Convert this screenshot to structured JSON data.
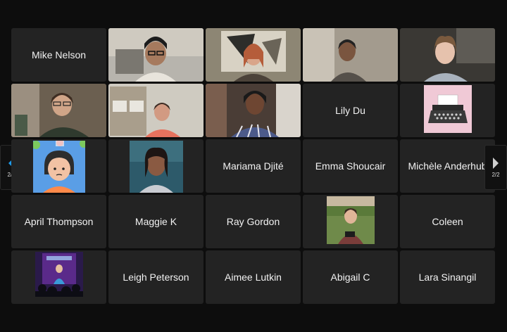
{
  "pagination": {
    "left_label": "2/2",
    "right_label": "2/2"
  },
  "participants": [
    {
      "name": "Mike Nelson",
      "video": false
    },
    {
      "name": "",
      "video": true,
      "icon": "person-video"
    },
    {
      "name": "",
      "video": true,
      "icon": "person-video"
    },
    {
      "name": "",
      "video": true,
      "icon": "person-video"
    },
    {
      "name": "",
      "video": true,
      "icon": "person-video"
    },
    {
      "name": "",
      "video": true,
      "icon": "person-video"
    },
    {
      "name": "",
      "video": true,
      "icon": "person-video"
    },
    {
      "name": "",
      "video": true,
      "icon": "person-video"
    },
    {
      "name": "Lily Du",
      "video": false
    },
    {
      "name": "",
      "video": false,
      "icon": "typewriter-avatar"
    },
    {
      "name": "",
      "video": false,
      "icon": "cartoon-avatar"
    },
    {
      "name": "",
      "video": false,
      "icon": "profile-photo"
    },
    {
      "name": "Mariama Djité",
      "video": false
    },
    {
      "name": "Emma Shoucair",
      "video": false
    },
    {
      "name": "Michèle Anderhub",
      "video": false
    },
    {
      "name": "April Thompson",
      "video": false
    },
    {
      "name": "Maggie K",
      "video": false
    },
    {
      "name": "Ray Gordon",
      "video": false
    },
    {
      "name": "",
      "video": false,
      "icon": "profile-photo"
    },
    {
      "name": "Coleen",
      "video": false
    },
    {
      "name": "",
      "video": false,
      "icon": "stage-photo"
    },
    {
      "name": "Leigh Peterson",
      "video": false
    },
    {
      "name": "Aimee Lutkin",
      "video": false
    },
    {
      "name": "Abigail C",
      "video": false
    },
    {
      "name": "Lara Sinangil",
      "video": false
    }
  ]
}
